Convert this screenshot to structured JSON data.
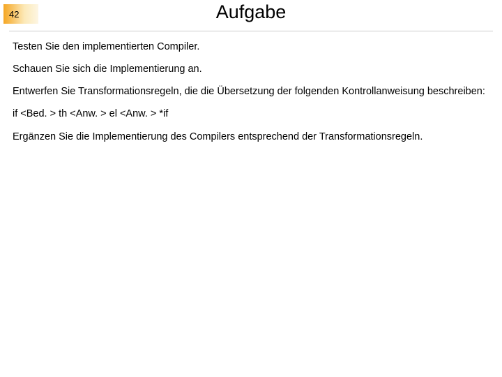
{
  "slide": {
    "number": "42",
    "title": "Aufgabe"
  },
  "body": {
    "p1": "Testen Sie den implementierten Compiler.",
    "p2": "Schauen Sie sich die Implementierung an.",
    "p3": "Entwerfen Sie Transformationsregeln, die die Übersetzung der folgenden Kontrollanweisung beschreiben:",
    "p4": "if <Bed. > th <Anw. > el <Anw. > *if",
    "p5": "Ergänzen Sie die Implementierung des Compilers entsprechend der Transformationsregeln."
  }
}
